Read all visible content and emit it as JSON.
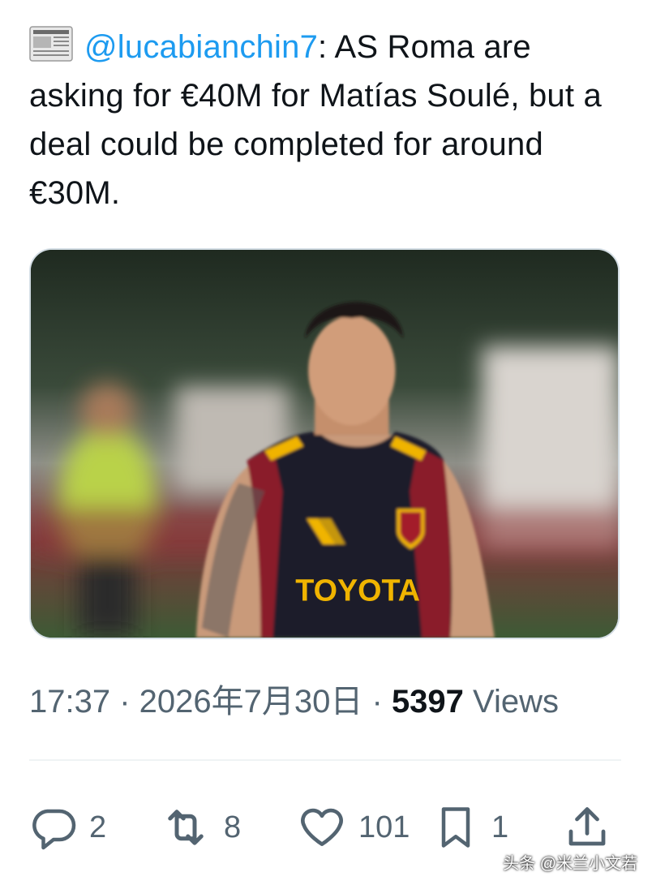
{
  "tweet": {
    "emoji": "newspaper-emoji",
    "mention": "@lucabianchin7",
    "text": ": AS Roma are asking for €40M for Matías Soulé, but a deal could be completed for around €30M."
  },
  "media": {
    "jersey_sponsor": "TOYOTA"
  },
  "meta": {
    "time": "17:37",
    "sep1": " · ",
    "date": "2026年7月30日",
    "sep2": " · ",
    "views_count": "5397",
    "views_label": " Views"
  },
  "actions": {
    "reply_count": "2",
    "retweet_count": "8",
    "like_count": "101",
    "bookmark_count": "1"
  },
  "watermark": "头条 @米兰小文若",
  "colors": {
    "accent": "#1d9bf0",
    "text": "#0f1419",
    "muted": "#536471"
  }
}
